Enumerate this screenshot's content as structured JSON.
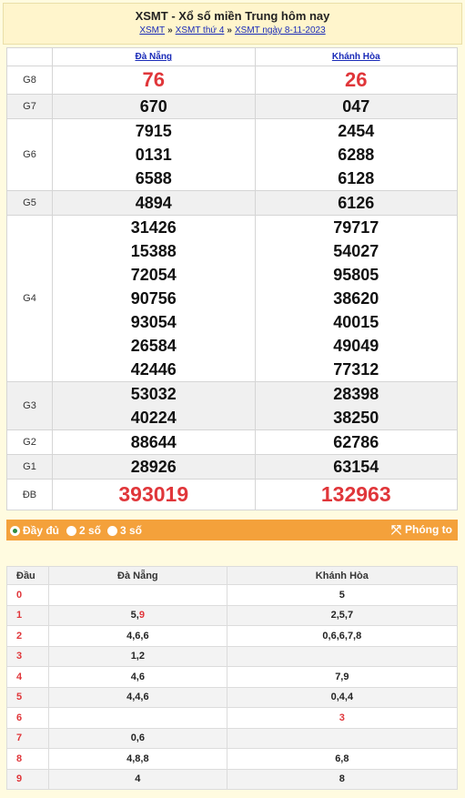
{
  "header": {
    "title": "XSMT - Xổ số miền Trung hôm nay",
    "crumbs": [
      "XSMT",
      "XSMT thứ 4",
      "XSMT ngày 8-11-2023"
    ],
    "separator": "»"
  },
  "provinces": [
    "Đà Nẵng",
    "Khánh Hòa"
  ],
  "prizes": [
    {
      "label": "G8",
      "values": [
        [
          "76"
        ],
        [
          "26"
        ]
      ]
    },
    {
      "label": "G7",
      "values": [
        [
          "670"
        ],
        [
          "047"
        ]
      ]
    },
    {
      "label": "G6",
      "values": [
        [
          "7915",
          "0131",
          "6588"
        ],
        [
          "2454",
          "6288",
          "6128"
        ]
      ]
    },
    {
      "label": "G5",
      "values": [
        [
          "4894"
        ],
        [
          "6126"
        ]
      ]
    },
    {
      "label": "G4",
      "values": [
        [
          "31426",
          "15388",
          "72054",
          "90756",
          "93054",
          "26584",
          "42446"
        ],
        [
          "79717",
          "54027",
          "95805",
          "38620",
          "40015",
          "49049",
          "77312"
        ]
      ]
    },
    {
      "label": "G3",
      "values": [
        [
          "53032",
          "40224"
        ],
        [
          "28398",
          "38250"
        ]
      ]
    },
    {
      "label": "G2",
      "values": [
        [
          "88644"
        ],
        [
          "62786"
        ]
      ]
    },
    {
      "label": "G1",
      "values": [
        [
          "28926"
        ],
        [
          "63154"
        ]
      ]
    },
    {
      "label": "ĐB",
      "values": [
        [
          "393019"
        ],
        [
          "132963"
        ]
      ]
    }
  ],
  "options": {
    "full": "Đầy đủ",
    "two": "2 số",
    "three": "3 số",
    "zoom": "Phóng to",
    "selected": "full"
  },
  "loto": {
    "headers": [
      "Đầu",
      "Đà Nẵng",
      "Khánh Hòa"
    ],
    "rows": [
      {
        "dau": "0",
        "a": "",
        "b": "5"
      },
      {
        "dau": "1",
        "a": "5,9",
        "b": "2,5,7"
      },
      {
        "dau": "2",
        "a": "4,6,6",
        "b": "0,6,6,7,8"
      },
      {
        "dau": "3",
        "a": "1,2",
        "b": ""
      },
      {
        "dau": "4",
        "a": "4,6",
        "b": "7,9"
      },
      {
        "dau": "5",
        "a": "4,4,6",
        "b": "0,4,4"
      },
      {
        "dau": "6",
        "a": "",
        "b": "3"
      },
      {
        "dau": "7",
        "a": "0,6",
        "b": ""
      },
      {
        "dau": "8",
        "a": "4,8,8",
        "b": "6,8"
      },
      {
        "dau": "9",
        "a": "4",
        "b": "8"
      }
    ]
  },
  "colors": {
    "accent": "#e0363a",
    "bar": "#f4a13b",
    "link": "#1a2bb8"
  }
}
